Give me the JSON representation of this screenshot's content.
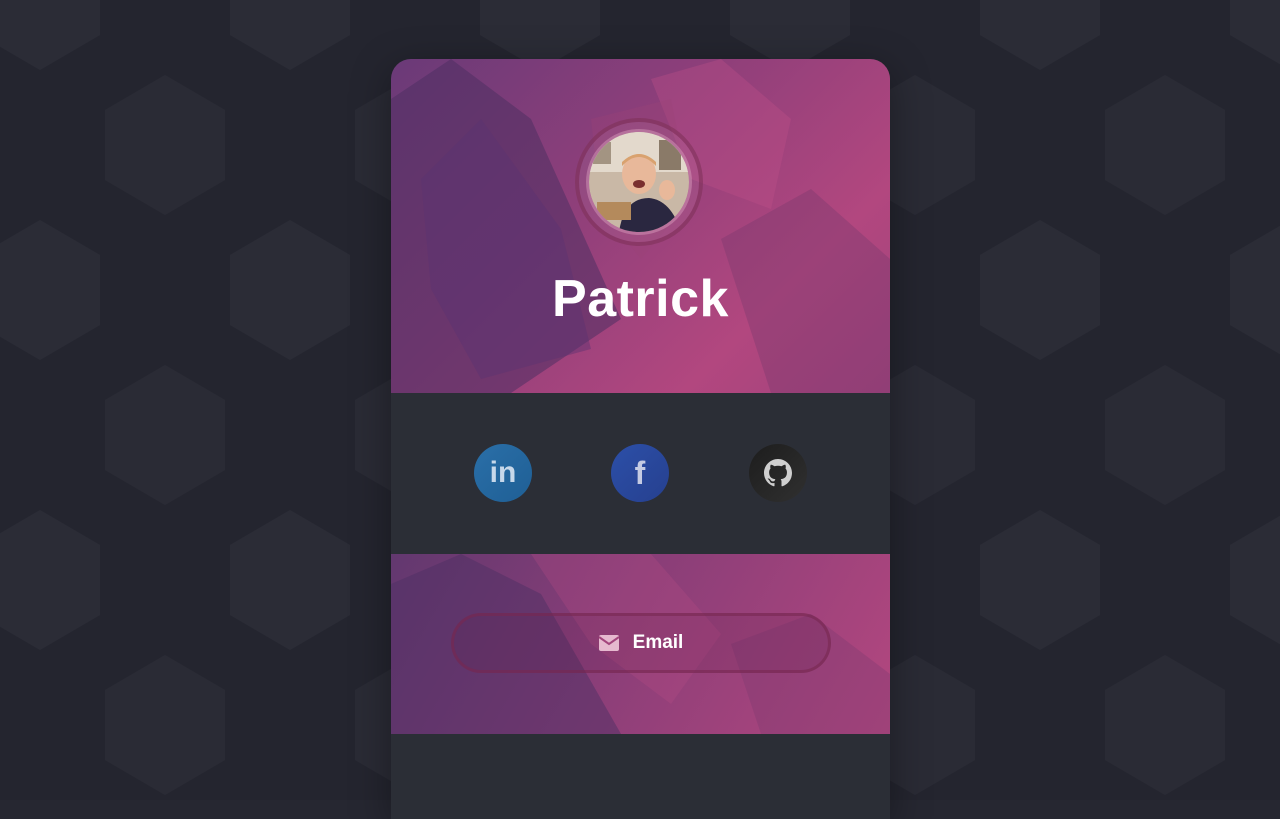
{
  "profile": {
    "name": "Patrick",
    "avatar_alt": "Profile photo"
  },
  "social": {
    "items": [
      {
        "id": "linkedin",
        "label": "in",
        "icon": "linkedin-icon"
      },
      {
        "id": "facebook",
        "label": "f",
        "icon": "facebook-icon"
      },
      {
        "id": "github",
        "label": "",
        "icon": "github-icon"
      }
    ]
  },
  "cta": {
    "email_label": "Email",
    "icon": "envelope-icon"
  },
  "colors": {
    "background": "#262731",
    "card_section": "#2b2e36",
    "hero_gradient_start": "#6a3a78",
    "hero_gradient_end": "#b2477f",
    "linkedin": "#2a6fa8",
    "facebook": "#2c4fa8",
    "github": "#1d1d1d"
  }
}
